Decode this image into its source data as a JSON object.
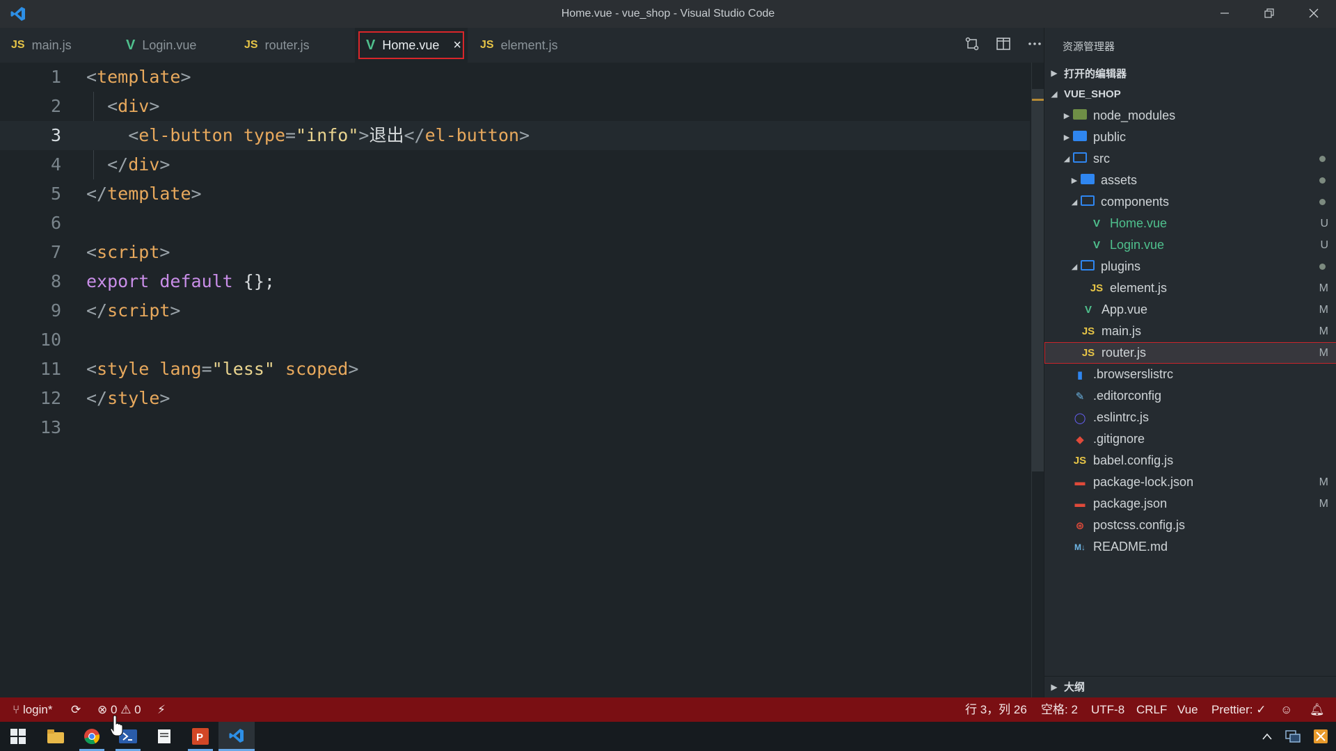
{
  "window": {
    "title": "Home.vue - vue_shop - Visual Studio Code",
    "minimize_icon": "minimize-icon",
    "restore_icon": "restore-icon",
    "close_icon": "close-icon"
  },
  "tabs": [
    {
      "label": "main.js",
      "icon": "JS",
      "active": false
    },
    {
      "label": "Login.vue",
      "icon": "V",
      "active": false
    },
    {
      "label": "router.js",
      "icon": "JS",
      "active": false
    },
    {
      "label": "Home.vue",
      "icon": "V",
      "active": true,
      "close": "×"
    },
    {
      "label": "element.js",
      "icon": "JS",
      "active": false
    }
  ],
  "editor": {
    "current_line": 3,
    "lines": [
      "1",
      "2",
      "3",
      "4",
      "5",
      "6",
      "7",
      "8",
      "9",
      "10",
      "11",
      "12",
      "13"
    ]
  },
  "sidebar": {
    "title": "资源管理器",
    "open_editors": "打开的编辑器",
    "project": "VUE_SHOP",
    "outline": "大纲",
    "tree": [
      {
        "label": "node_modules",
        "badge": ""
      },
      {
        "label": "public",
        "badge": ""
      },
      {
        "label": "src",
        "badge": "dot"
      },
      {
        "label": "assets",
        "badge": "dot"
      },
      {
        "label": "components",
        "badge": "dot"
      },
      {
        "label": "Home.vue",
        "badge": "U"
      },
      {
        "label": "Login.vue",
        "badge": "U"
      },
      {
        "label": "plugins",
        "badge": "dot"
      },
      {
        "label": "element.js",
        "badge": "M"
      },
      {
        "label": "App.vue",
        "badge": "M"
      },
      {
        "label": "main.js",
        "badge": "M"
      },
      {
        "label": "router.js",
        "badge": "M"
      },
      {
        "label": ".browserslistrc",
        "badge": ""
      },
      {
        "label": ".editorconfig",
        "badge": ""
      },
      {
        "label": ".eslintrc.js",
        "badge": ""
      },
      {
        "label": ".gitignore",
        "badge": ""
      },
      {
        "label": "babel.config.js",
        "badge": ""
      },
      {
        "label": "package-lock.json",
        "badge": "M"
      },
      {
        "label": "package.json",
        "badge": "M"
      },
      {
        "label": "postcss.config.js",
        "badge": ""
      },
      {
        "label": "README.md",
        "badge": ""
      }
    ]
  },
  "status": {
    "branch": "login*",
    "errors": "0",
    "warnings": "0",
    "position": "行 3，列 26",
    "spaces": "空格: 2",
    "encoding": "UTF-8",
    "eol": "CRLF",
    "language": "Vue",
    "prettier": "Prettier: ✓"
  },
  "colors": {
    "statusbar": "#7a0f13",
    "active_tab_outline": "#d9262a",
    "vue_green": "#4fc08d",
    "js_yellow": "#e7c547"
  }
}
